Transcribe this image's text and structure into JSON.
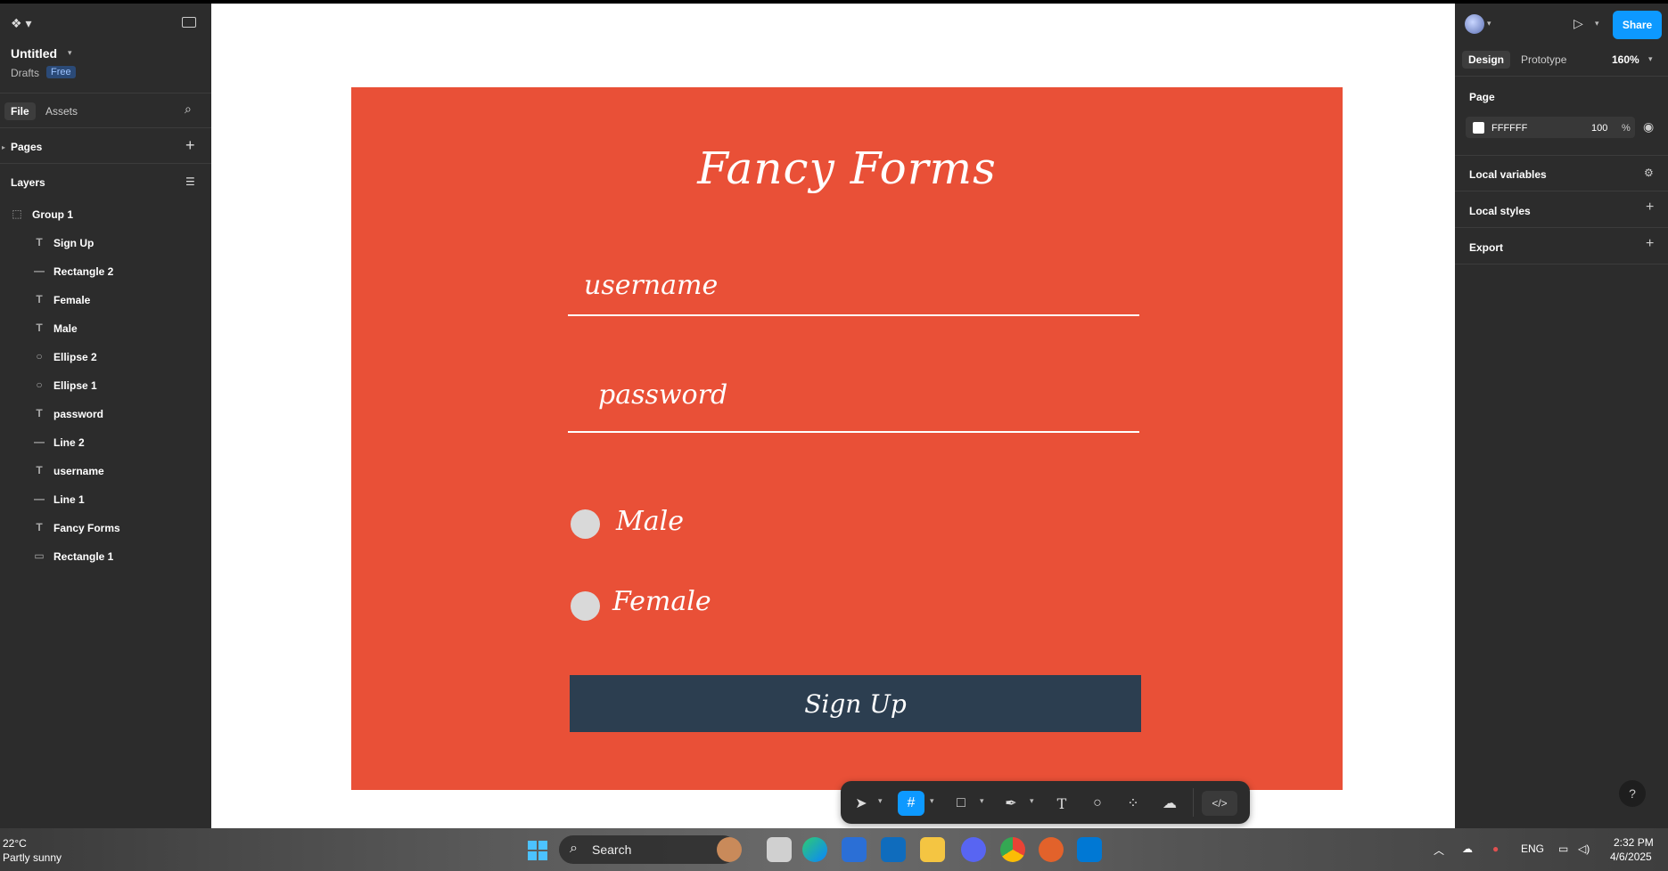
{
  "file": {
    "title": "Untitled",
    "location": "Drafts",
    "plan_badge": "Free"
  },
  "left_tabs": {
    "file": "File",
    "assets": "Assets"
  },
  "sections": {
    "pages": "Pages",
    "layers": "Layers"
  },
  "layers": [
    {
      "label": "Group 1",
      "icon": "group-icon"
    },
    {
      "label": "Sign Up",
      "icon": "text-icon"
    },
    {
      "label": "Rectangle 2",
      "icon": "line-icon"
    },
    {
      "label": "Female",
      "icon": "text-icon"
    },
    {
      "label": "Male",
      "icon": "text-icon"
    },
    {
      "label": "Ellipse 2",
      "icon": "ellipse-icon"
    },
    {
      "label": "Ellipse 1",
      "icon": "ellipse-icon"
    },
    {
      "label": "password",
      "icon": "text-icon"
    },
    {
      "label": "Line 2",
      "icon": "line-icon"
    },
    {
      "label": "username",
      "icon": "text-icon"
    },
    {
      "label": "Line 1",
      "icon": "line-icon"
    },
    {
      "label": "Fancy Forms",
      "icon": "text-icon"
    },
    {
      "label": "Rectangle 1",
      "icon": "rectangle-icon"
    }
  ],
  "design": {
    "title": "Fancy Forms",
    "username_placeholder": "username",
    "password_placeholder": "password",
    "option_male": "Male",
    "option_female": "Female",
    "button": "Sign Up",
    "frame_color": "#e95037",
    "button_color": "#2c3e50"
  },
  "right": {
    "share": "Share",
    "tab_design": "Design",
    "tab_prototype": "Prototype",
    "zoom": "160%",
    "page_label": "Page",
    "page_color": "FFFFFF",
    "page_opacity": "100",
    "percent": "%",
    "local_variables": "Local variables",
    "local_styles": "Local styles",
    "export": "Export",
    "help": "?"
  },
  "taskbar": {
    "temp": "22°C",
    "weather": "Partly sunny",
    "search": "Search",
    "lang": "ENG",
    "time": "2:32 PM",
    "date": "4/6/2025"
  }
}
